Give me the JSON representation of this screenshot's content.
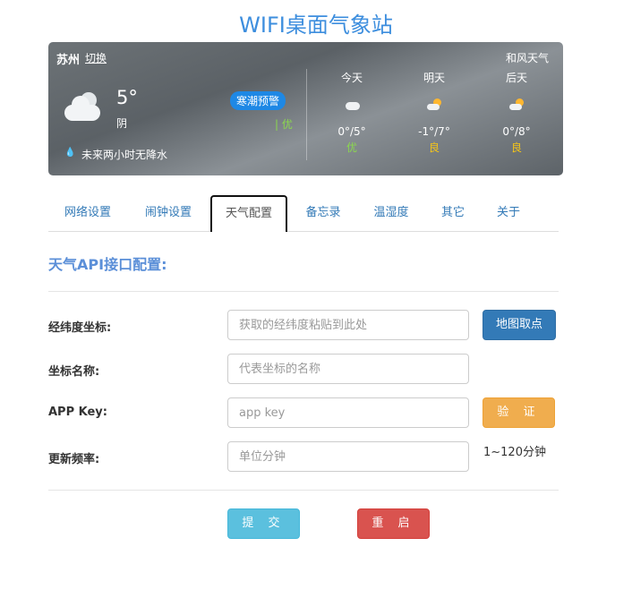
{
  "page_title": "WIFI桌面气象站",
  "weather": {
    "city": "苏州",
    "switch_label": "切换",
    "provider": "和风天气",
    "current_temp": "5°",
    "current_condition": "阴",
    "alert_badge": "寒潮预警",
    "aqi": "| 优",
    "rain_forecast": "未来两小时无降水",
    "days": [
      {
        "label": "今天",
        "icon": "cloudy-icon",
        "range": "0°/5°",
        "quality": "优",
        "quality_color": "#8bd84e"
      },
      {
        "label": "明天",
        "icon": "sun-cloud-icon",
        "range": "-1°/7°",
        "quality": "良",
        "quality_color": "#f5c518"
      },
      {
        "label": "后天",
        "icon": "sun-cloud-icon",
        "range": "0°/8°",
        "quality": "良",
        "quality_color": "#f5c518"
      }
    ]
  },
  "tabs": [
    "网络设置",
    "闹钟设置",
    "天气配置",
    "备忘录",
    "温湿度",
    "其它",
    "关于"
  ],
  "active_tab": "天气配置",
  "form": {
    "section_title": "天气API接口配置:",
    "coords_label": "经纬度坐标:",
    "coords_placeholder": "获取的经纬度粘贴到此处",
    "map_button": "地图取点",
    "name_label": "坐标名称:",
    "name_placeholder": "代表坐标的名称",
    "key_label": "APP Key:",
    "key_placeholder": "app key",
    "verify_button": "验 证",
    "freq_label": "更新频率:",
    "freq_placeholder": "单位分钟",
    "freq_hint": "1~120分钟",
    "submit_button": "提 交",
    "restart_button": "重 启"
  }
}
